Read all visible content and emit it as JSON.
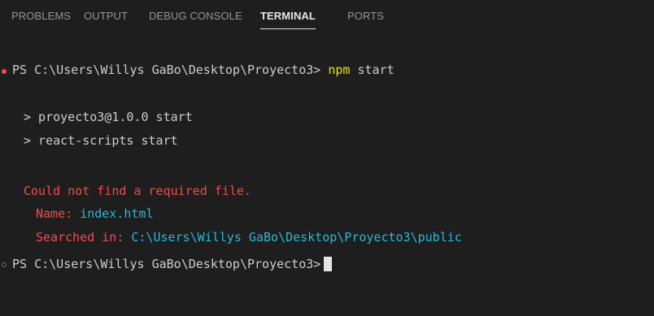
{
  "tabs": [
    {
      "label": "PROBLEMS",
      "active": false
    },
    {
      "label": "OUTPUT",
      "active": false
    },
    {
      "label": "DEBUG CONSOLE",
      "active": false
    },
    {
      "label": "TERMINAL",
      "active": true
    },
    {
      "label": "PORTS",
      "active": false
    }
  ],
  "terminal": {
    "command_prompt": "PS C:\\Users\\Willys GaBo\\Desktop\\Proyecto3>",
    "command_npm": "npm",
    "command_args": "start",
    "script_line_1": "> proyecto3@1.0.0 start",
    "script_line_2": "> react-scripts start",
    "error_message": "Could not find a required file.",
    "name_label": "Name:",
    "name_value": "index.html",
    "searched_label": "Searched in:",
    "searched_value": "C:\\Users\\Willys GaBo\\Desktop\\Proyecto3\\public",
    "final_prompt": "PS C:\\Users\\Willys GaBo\\Desktop\\Proyecto3>"
  },
  "colors": {
    "background": "#1e1e1e",
    "tab_inactive": "#969696",
    "tab_active": "#e7e7e7",
    "text": "#cccccc",
    "npm_yellow": "#e5e510",
    "error_red": "#f14c4c",
    "info_cyan": "#29b8db"
  },
  "icons": {
    "error_decoration": "error-dot-icon",
    "neutral_decoration": "hollow-dot-icon",
    "cursor": "block-cursor"
  }
}
